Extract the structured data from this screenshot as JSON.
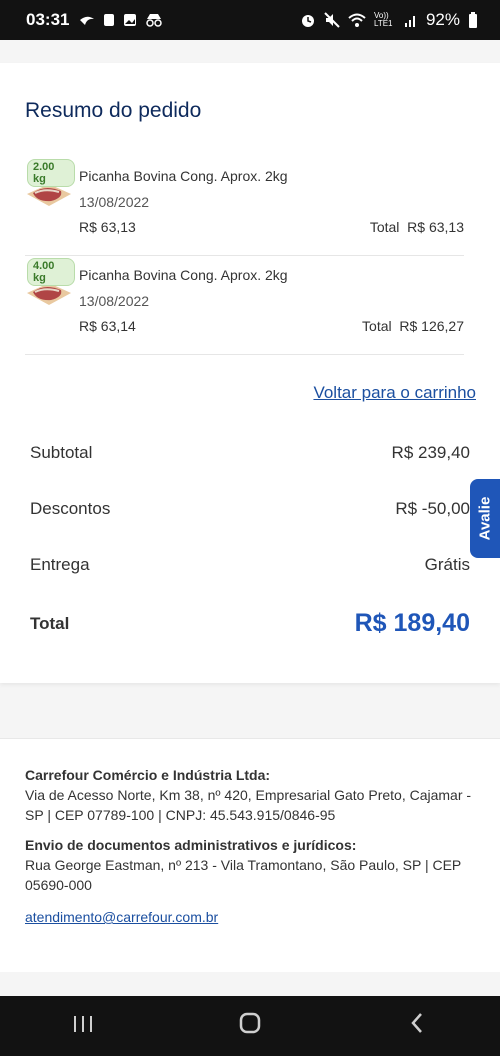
{
  "status_bar": {
    "time": "03:31",
    "network": "Vo)) LTE1",
    "battery": "92%"
  },
  "order_summary": {
    "title": "Resumo do pedido",
    "items": [
      {
        "weight_badge": "2.00 kg",
        "name": "Picanha Bovina Cong. Aprox. 2kg",
        "date": "13/08/2022",
        "price": "R$ 63,13",
        "total_label": "Total",
        "total_value": "R$ 63,13"
      },
      {
        "weight_badge": "4.00 kg",
        "name": "Picanha Bovina Cong. Aprox. 2kg",
        "date": "13/08/2022",
        "price": "R$ 63,14",
        "total_label": "Total",
        "total_value": "R$ 126,27"
      }
    ],
    "back_link": "Voltar para o carrinho",
    "subtotal_label": "Subtotal",
    "subtotal_value": "R$ 239,40",
    "discount_label": "Descontos",
    "discount_value": "R$ -50,00",
    "delivery_label": "Entrega",
    "delivery_value": "Grátis",
    "total_label": "Total",
    "total_value": "R$ 189,40"
  },
  "feedback_tab": "Avalie",
  "footer": {
    "company_title": "Carrefour Comércio e Indústria Ltda:",
    "company_address": "Via de Acesso Norte, Km 38, nº 420, Empresarial Gato Preto, Cajamar - SP | CEP 07789-100 | CNPJ: 45.543.915/0846-95",
    "docs_title": "Envio de documentos administrativos e jurídicos:",
    "docs_address": "Rua George Eastman, nº 213 - Vila Tramontano, São Paulo, SP | CEP 05690-000",
    "email": "atendimento@carrefour.com.br"
  },
  "colors": {
    "accent": "#1f56b8",
    "title": "#0e2a5c",
    "link": "#1b4fa0",
    "badge_bg": "#dff1d6",
    "badge_text": "#3a7a2a"
  }
}
